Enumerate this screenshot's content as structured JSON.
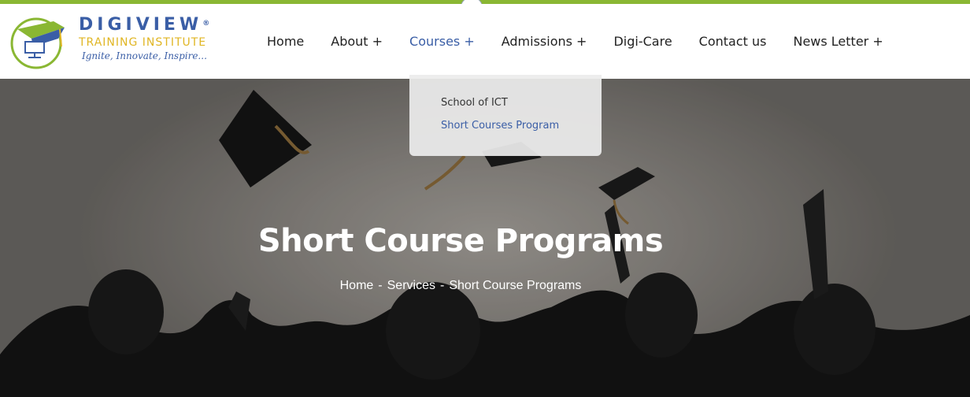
{
  "colors": {
    "accent": "#8ab733",
    "brand_blue": "#3a5ea6",
    "brand_gold": "#e0b624"
  },
  "logo": {
    "brand": "DIGIVIEW",
    "registered": "®",
    "sub": "TRAINING INSTITUTE",
    "tagline": "Ignite, Innovate, Inspire..."
  },
  "nav": {
    "home": "Home",
    "about": "About +",
    "courses": "Courses +",
    "admissions": "Admissions +",
    "digicare": "Digi-Care",
    "contact": "Contact us",
    "newsletter": "News Letter +"
  },
  "dropdown": {
    "items": [
      "School of ICT",
      "Short Courses Program"
    ]
  },
  "hero": {
    "title": "Short Course Programs",
    "breadcrumb": [
      "Home",
      "Services",
      "Short Course Programs"
    ],
    "separator": "-"
  }
}
